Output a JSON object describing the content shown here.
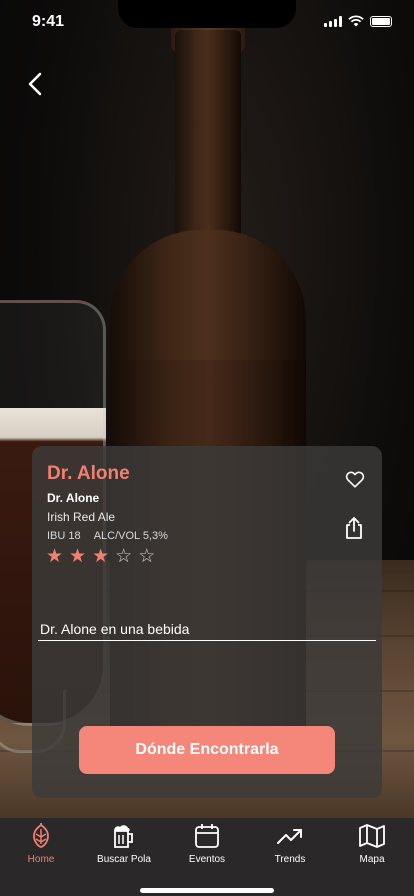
{
  "status_bar": {
    "time": "9:41"
  },
  "beer": {
    "name": "Dr. Alone",
    "brewery": "Dr. Alone",
    "style": "Irish Red Ale",
    "ibu": "IBU 18",
    "abv": "ALC/VOL 5,3%",
    "rating": 3,
    "rating_max": 5
  },
  "drink_input": {
    "value": "Dr. Alone en una bebida"
  },
  "find_button": {
    "label": "Dónde Encontrarla"
  },
  "tabs": [
    {
      "label": "Home",
      "icon": "hop-icon",
      "active": true
    },
    {
      "label": "Buscar Pola",
      "icon": "beer-mug-icon",
      "active": false
    },
    {
      "label": "Eventos",
      "icon": "calendar-icon",
      "active": false
    },
    {
      "label": "Trends",
      "icon": "trend-up-icon",
      "active": false
    },
    {
      "label": "Mapa",
      "icon": "map-icon",
      "active": false
    }
  ],
  "colors": {
    "accent": "#f08170",
    "button": "#f5877a",
    "card": "#3c3a39",
    "tabbar": "#2a2828"
  }
}
